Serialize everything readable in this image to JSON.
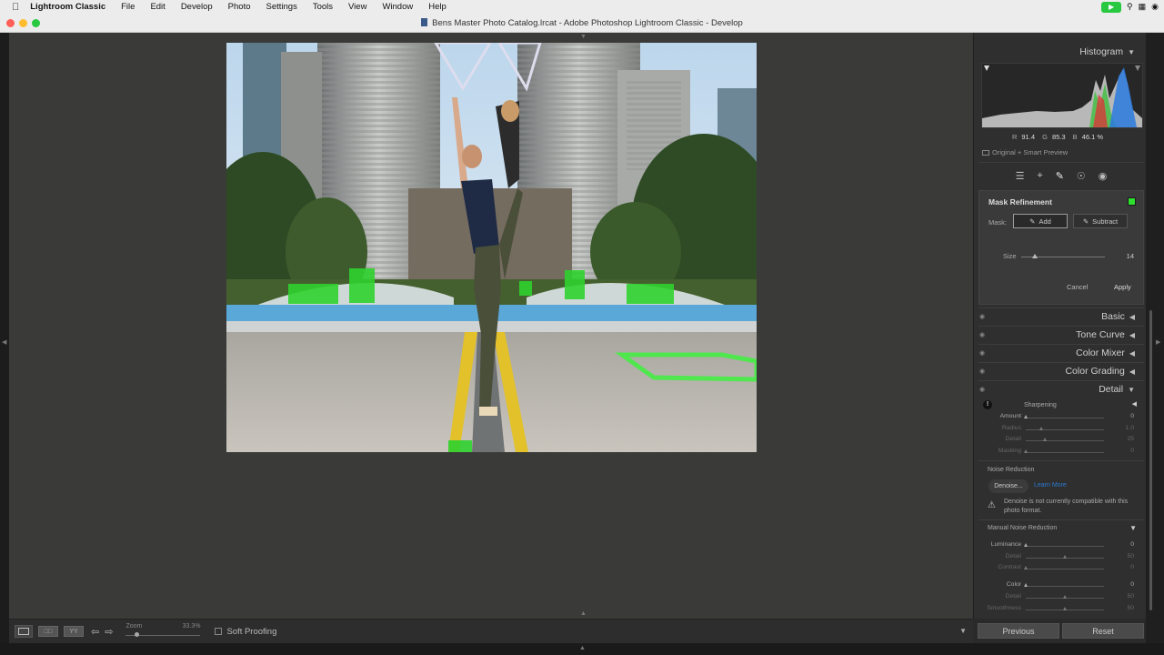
{
  "menubar": {
    "items": [
      "Lightroom Classic",
      "File",
      "Edit",
      "Develop",
      "Photo",
      "Settings",
      "Tools",
      "View",
      "Window",
      "Help"
    ]
  },
  "window": {
    "title": "Bens Master Photo Catalog.lrcat - Adobe Photoshop Lightroom Classic - Develop"
  },
  "filmstrip": {
    "view_grid_label": "□□",
    "view_compare_label": "YY",
    "zoom_label": "Zoom",
    "zoom_value": "33.3%",
    "zoom_fraction": 0.15,
    "soft_proofing_label": "Soft Proofing"
  },
  "histogram": {
    "title": "Histogram",
    "r_label": "R",
    "r_value": "91.4",
    "g_label": "G",
    "g_value": "85.3",
    "b_label": "B",
    "b_value": "46.1 %",
    "preview_label": "Original + Smart Preview"
  },
  "mask_refinement": {
    "title": "Mask Refinement",
    "swatch_color": "#2ee02e",
    "mask_label": "Mask:",
    "add_label": "Add",
    "subtract_label": "Subtract",
    "size_label": "Size",
    "size_value": "14",
    "cancel_label": "Cancel",
    "apply_label": "Apply"
  },
  "sections": {
    "basic": "Basic",
    "tone_curve": "Tone Curve",
    "color_mixer": "Color Mixer",
    "color_grading": "Color Grading",
    "detail": "Detail"
  },
  "sharpening": {
    "title": "Sharpening",
    "sliders": [
      {
        "label": "Amount",
        "value": "0",
        "fraction": 0.0,
        "enabled": true
      },
      {
        "label": "Radius",
        "value": "1.0",
        "fraction": 0.2,
        "enabled": false
      },
      {
        "label": "Detail",
        "value": "25",
        "fraction": 0.25,
        "enabled": false
      },
      {
        "label": "Masking",
        "value": "0",
        "fraction": 0.0,
        "enabled": false
      }
    ]
  },
  "noise_reduction": {
    "title": "Noise Reduction",
    "denoise_label": "Denoise...",
    "learn_more_label": "Learn More",
    "warning_text": "Denoise is not currently compatible with this photo format.",
    "manual_title": "Manual Noise Reduction",
    "sliders": [
      {
        "label": "Luminance",
        "value": "0",
        "fraction": 0.0,
        "enabled": true
      },
      {
        "label": "Detail",
        "value": "50",
        "fraction": 0.5,
        "enabled": false
      },
      {
        "label": "Contrast",
        "value": "0",
        "fraction": 0.0,
        "enabled": false
      },
      {
        "label": "Color",
        "value": "0",
        "fraction": 0.0,
        "enabled": true
      },
      {
        "label": "Detail",
        "value": "50",
        "fraction": 0.5,
        "enabled": false
      },
      {
        "label": "Smoothness",
        "value": "50",
        "fraction": 0.5,
        "enabled": false
      }
    ]
  },
  "footer": {
    "previous_label": "Previous",
    "reset_label": "Reset"
  }
}
